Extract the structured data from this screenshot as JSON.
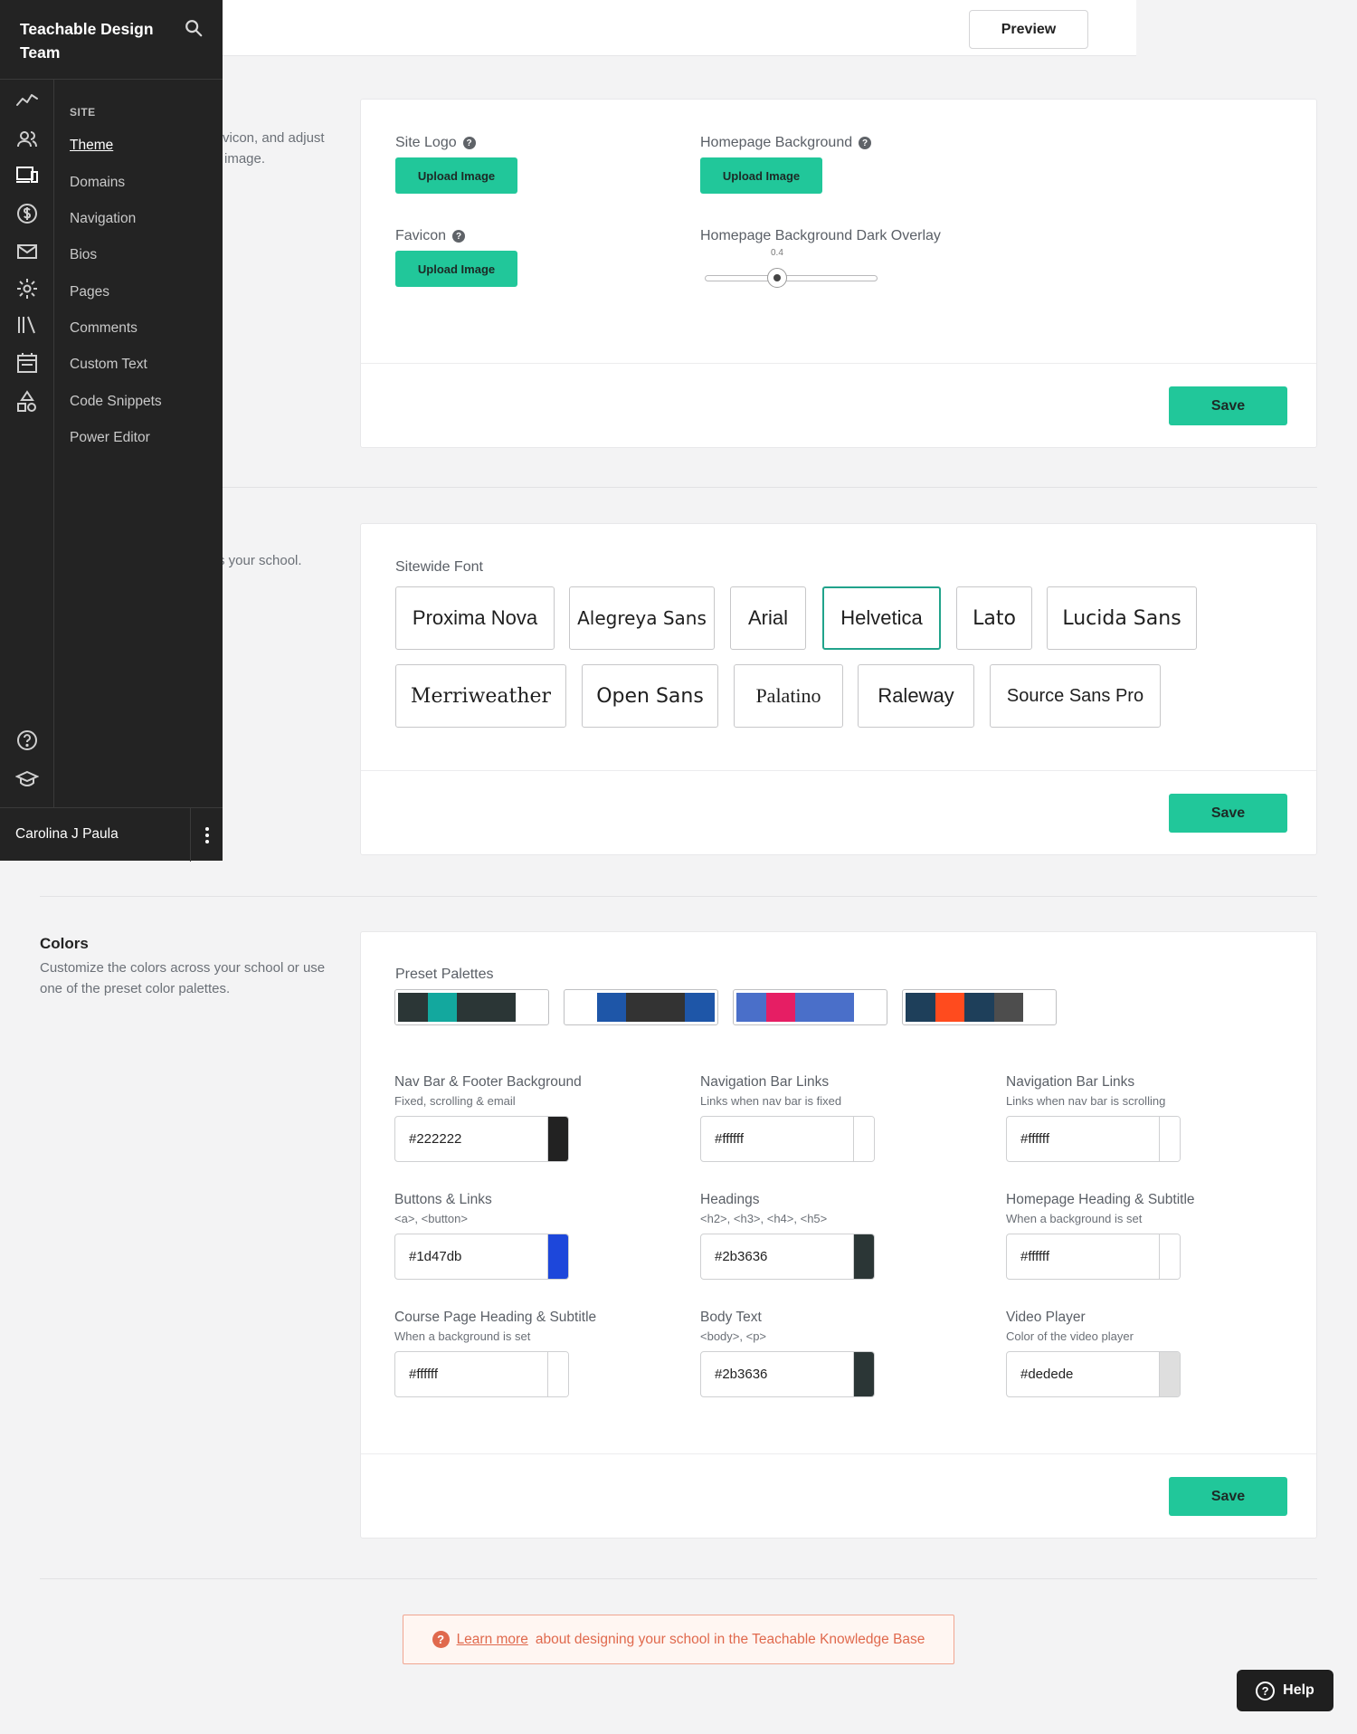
{
  "topbar": {
    "preview_label": "Preview"
  },
  "sidebar": {
    "school_name": "Teachable Design Team",
    "section_label": "SITE",
    "items": [
      {
        "label": "Theme"
      },
      {
        "label": "Domains"
      },
      {
        "label": "Navigation"
      },
      {
        "label": "Bios"
      },
      {
        "label": "Pages"
      },
      {
        "label": "Comments"
      },
      {
        "label": "Custom Text"
      },
      {
        "label": "Code Snippets"
      },
      {
        "label": "Power Editor"
      }
    ],
    "rail_icons": [
      "analytics-icon",
      "users-icon",
      "site-icon",
      "sales-icon",
      "email-icon",
      "settings-icon",
      "library-icon",
      "calendar-icon",
      "shapes-icon",
      "help-icon",
      "academy-icon"
    ],
    "user_name": "Carolina J Paula"
  },
  "logo_section": {
    "desc_fragment_1": "vicon, and adjust",
    "desc_fragment_2": "image.",
    "site_logo_label": "Site Logo",
    "favicon_label": "Favicon",
    "homepage_bg_label": "Homepage Background",
    "overlay_label": "Homepage Background Dark Overlay",
    "upload_label": "Upload Image",
    "overlay_value": "0.4",
    "save_label": "Save"
  },
  "fonts_section": {
    "desc_fragment": "s your school.",
    "label": "Sitewide Font",
    "fonts": [
      "Proxima Nova",
      "Alegreya Sans",
      "Arial",
      "Helvetica",
      "Lato",
      "Lucida Sans",
      "Merriweather",
      "Open Sans",
      "Palatino",
      "Raleway",
      "Source Sans Pro"
    ],
    "selected": "Helvetica",
    "save_label": "Save"
  },
  "colors_section": {
    "title": "Colors",
    "description": "Customize the colors across your school or use one of the preset color palettes.",
    "palettes_label": "Preset Palettes",
    "palettes": [
      [
        "#2b3636",
        "#13a89e",
        "#2b3636",
        "#2b3636",
        "#ffffff"
      ],
      [
        "#ffffff",
        "#1e56a8",
        "#333333",
        "#333333",
        "#1e56a8"
      ],
      [
        "#4a6fc9",
        "#e61e64",
        "#4a6fc9",
        "#4a6fc9",
        "#ffffff"
      ],
      [
        "#1e3f5a",
        "#ff4b1e",
        "#1e3f5a",
        "#4d4d4d",
        "#ffffff"
      ]
    ],
    "fields": [
      {
        "label": "Nav Bar & Footer Background",
        "sub": "Fixed, scrolling & email",
        "value": "#222222",
        "color": "#222222"
      },
      {
        "label": "Navigation Bar Links",
        "sub": "Links when nav bar is fixed",
        "value": "#ffffff",
        "color": "#ffffff"
      },
      {
        "label": "Navigation Bar Links",
        "sub": "Links when nav bar is scrolling",
        "value": "#ffffff",
        "color": "#ffffff"
      },
      {
        "label": "Buttons & Links",
        "sub": "<a>, <button>",
        "value": "#1d47db",
        "color": "#1d47db"
      },
      {
        "label": "Headings",
        "sub": "<h2>, <h3>, <h4>, <h5>",
        "value": "#2b3636",
        "color": "#2b3636"
      },
      {
        "label": "Homepage Heading & Subtitle",
        "sub": "When a background is set",
        "value": "#ffffff",
        "color": "#ffffff"
      },
      {
        "label": "Course Page Heading & Subtitle",
        "sub": "When a background is set",
        "value": "#ffffff",
        "color": "#ffffff"
      },
      {
        "label": "Body Text",
        "sub": "<body>, <p>",
        "value": "#2b3636",
        "color": "#2b3636"
      },
      {
        "label": "Video Player",
        "sub": "Color of the video player",
        "value": "#dedede",
        "color": "#dedede"
      }
    ],
    "save_label": "Save"
  },
  "info_banner": {
    "link_text": "Learn more",
    "text": "about designing your school in the Teachable Knowledge Base"
  },
  "help_button": {
    "label": "Help"
  }
}
